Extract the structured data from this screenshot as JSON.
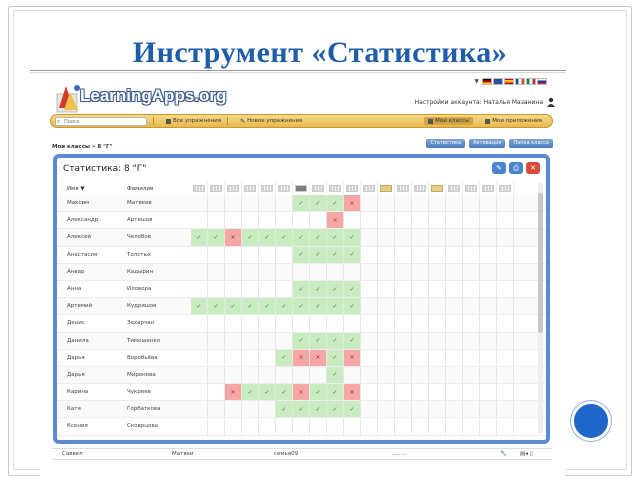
{
  "slide": {
    "title": "Инструмент «Статистика»"
  },
  "app": {
    "logo_text": "LearningApps.org",
    "account_text": "Настройки аккаунта: Наталья Мазанина",
    "flag_colors": [
      "#d33a2c",
      "#2c4fa8",
      "#f0c24a",
      "#3f8a3a",
      "#3a63b8"
    ],
    "search_placeholder": "Поиск",
    "nav": {
      "all_exercises": "Все упражнения",
      "new_exercise": "Новое упражнение",
      "my_classes": "Мои классы",
      "my_apps": "Мои приложения"
    },
    "subheader": "Мои классы » 8 \"Г\"",
    "buttons": {
      "statistics": "Статистика",
      "activation": "Активация",
      "class_folder": "Папка класса"
    }
  },
  "panel": {
    "title": "Статистика: 8 \"Г\"",
    "col_first": "Имя ▼",
    "col_last": "Фамилия",
    "header_dark_index": 6,
    "header_yellow_indices": [
      11,
      14
    ],
    "rows": [
      {
        "first": "Максим",
        "last": "Матвеев",
        "cells": [
          "",
          "",
          "",
          "",
          "",
          "",
          "ok",
          "ok",
          "ok",
          "bad",
          "",
          "",
          "",
          "",
          "",
          "",
          "",
          "",
          ""
        ]
      },
      {
        "first": "Александр",
        "last": "Артешов",
        "cells": [
          "",
          "",
          "",
          "",
          "",
          "",
          "",
          "",
          "bad",
          "",
          "",
          "",
          "",
          "",
          "",
          "",
          "",
          "",
          ""
        ]
      },
      {
        "first": "Алексей",
        "last": "Челобов",
        "cells": [
          "ok",
          "ok",
          "bad",
          "ok",
          "ok",
          "ok",
          "ok",
          "ok",
          "ok",
          "ok",
          "",
          "",
          "",
          "",
          "",
          "",
          "",
          "",
          ""
        ]
      },
      {
        "first": "Анастасия",
        "last": "Толстых",
        "cells": [
          "",
          "",
          "",
          "",
          "",
          "",
          "ok",
          "ok",
          "ok",
          "ok",
          "",
          "",
          "",
          "",
          "",
          "",
          "",
          "",
          ""
        ]
      },
      {
        "first": "Анвар",
        "last": "Кадырин",
        "cells": [
          "",
          "",
          "",
          "",
          "",
          "",
          "",
          "",
          "",
          "",
          "",
          "",
          "",
          "",
          "",
          "",
          "",
          "",
          ""
        ]
      },
      {
        "first": "Анна",
        "last": "Иловора",
        "cells": [
          "",
          "",
          "",
          "",
          "",
          "",
          "ok",
          "ok",
          "ok",
          "ok",
          "",
          "",
          "",
          "",
          "",
          "",
          "",
          "",
          ""
        ]
      },
      {
        "first": "Артемий",
        "last": "Кудряшов",
        "cells": [
          "ok",
          "ok",
          "ok",
          "ok",
          "ok",
          "ok",
          "ok",
          "ok",
          "ok",
          "ok",
          "",
          "",
          "",
          "",
          "",
          "",
          "",
          "",
          ""
        ]
      },
      {
        "first": "Денис",
        "last": "Захарчан",
        "cells": [
          "",
          "",
          "",
          "",
          "",
          "",
          "",
          "",
          "",
          "",
          "",
          "",
          "",
          "",
          "",
          "",
          "",
          "",
          ""
        ]
      },
      {
        "first": "Данила",
        "last": "Тимошенко",
        "cells": [
          "",
          "",
          "",
          "",
          "",
          "",
          "ok",
          "ok",
          "ok",
          "ok",
          "",
          "",
          "",
          "",
          "",
          "",
          "",
          "",
          ""
        ]
      },
      {
        "first": "Дарья",
        "last": "Воробьёва",
        "cells": [
          "",
          "",
          "",
          "",
          "",
          "ok",
          "bad",
          "bad",
          "ok",
          "bad",
          "",
          "",
          "",
          "",
          "",
          "",
          "",
          "",
          ""
        ]
      },
      {
        "first": "Дарья",
        "last": "Миронова",
        "cells": [
          "",
          "",
          "",
          "",
          "",
          "",
          "",
          "",
          "ok",
          "",
          "",
          "",
          "",
          "",
          "",
          "",
          "",
          "",
          ""
        ]
      },
      {
        "first": "Карина",
        "last": "Чукреев",
        "cells": [
          "",
          "",
          "bad",
          "ok",
          "ok",
          "ok",
          "bad",
          "ok",
          "ok",
          "bad",
          "",
          "",
          "",
          "",
          "",
          "",
          "",
          "",
          ""
        ]
      },
      {
        "first": "Катя",
        "last": "Горбаткова",
        "cells": [
          "",
          "",
          "",
          "",
          "",
          "ok",
          "ok",
          "ok",
          "ok",
          "ok",
          "",
          "",
          "",
          "",
          "",
          "",
          "",
          "",
          ""
        ]
      },
      {
        "first": "Ксения",
        "last": "Сковрцова",
        "cells": [
          "",
          "",
          "",
          "",
          "",
          "",
          "",
          "",
          "",
          "",
          "",
          "",
          "",
          "",
          "",
          "",
          "",
          "",
          ""
        ]
      }
    ]
  },
  "bottom_row": {
    "a": "Саввел",
    "b": "Матвеи",
    "c": "семья09",
    "d": "........"
  }
}
